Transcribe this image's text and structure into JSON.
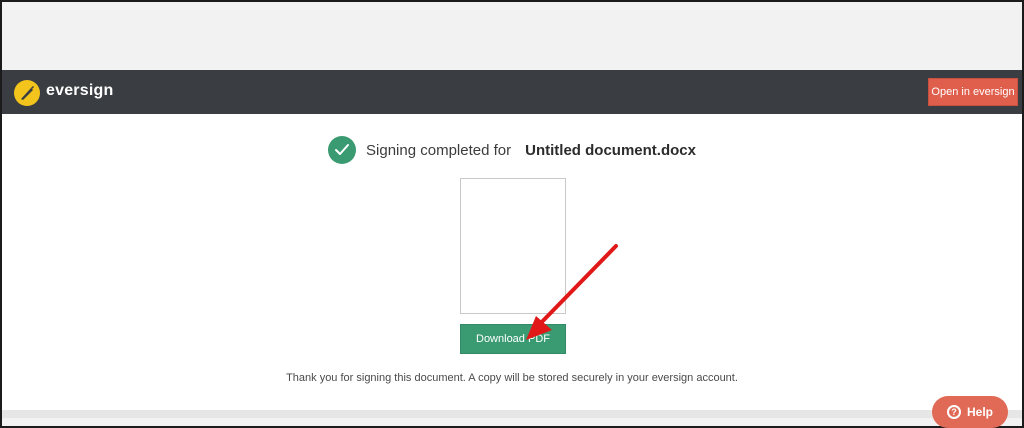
{
  "header": {
    "brand": "eversign",
    "open_button": "Open in eversign"
  },
  "status": {
    "prefix": "Signing completed for",
    "document_name": "Untitled document.docx"
  },
  "preview": {},
  "actions": {
    "download_label": "Download PDF"
  },
  "footer": {
    "thanks_text": "Thank you for signing this document. A copy will be stored securely in your eversign account."
  },
  "help": {
    "label": "Help",
    "icon_glyph": "?"
  },
  "colors": {
    "header_bg": "#3a3d42",
    "brand_yellow": "#f3c41b",
    "accent_green": "#3a9b73",
    "accent_red": "#e05f4c",
    "arrow_red": "#e01818"
  }
}
